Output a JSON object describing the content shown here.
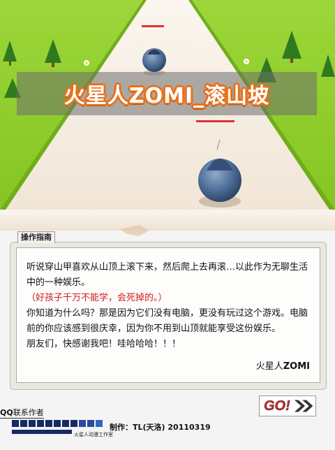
{
  "game": {
    "title": "火星人ZOMI_滚山坡"
  },
  "guide": {
    "tab_label": "操作指南",
    "paragraph1": "听说穿山甲喜欢从山顶上滚下来，然后爬上去再滚…以此作为无聊生活中的一种娱乐。",
    "warning": "（好孩子千万不能学，会死掉的。）",
    "paragraph2": "你知道为什么吗？那是因为它们没有电脑，更没有玩过这个游戏。电脑前的你应该感到很庆幸，因为你不用到山顶就能享受这份娱乐。",
    "paragraph3": "朋友们，快感谢我吧！哇哈哈哈！！！",
    "signature_prefix": "火星人",
    "signature_name": "ZOMI"
  },
  "footer": {
    "contact_prefix": "QQ",
    "contact_suffix": "联系作者",
    "go_label": "GO!",
    "credit": "制作：TL(天洛) 20110319",
    "studio": "火星人动漫工作室"
  },
  "colors": {
    "grass": "#8ccc2a",
    "road": "#f3e9dc",
    "accent_orange": "#e8701a",
    "warn_red": "#d01a1a",
    "go_red": "#d42020"
  },
  "icons": [
    "pangolin-ball-icon",
    "tree-icon",
    "flower-icon",
    "double-chevron-icon",
    "studio-logo-icon"
  ]
}
